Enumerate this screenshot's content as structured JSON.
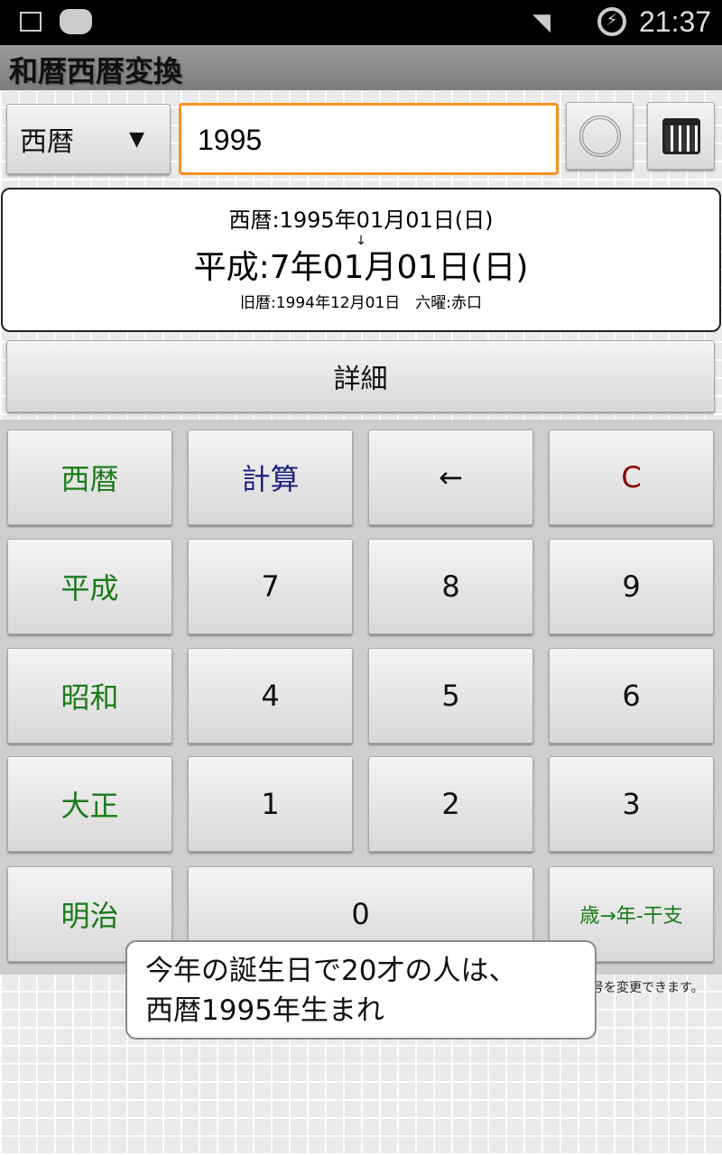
{
  "status": {
    "time": "21:37"
  },
  "app": {
    "title": "和暦西暦変換"
  },
  "input": {
    "era_select": "西暦",
    "value": "1995"
  },
  "result": {
    "western": "西暦:1995年01月01日(日)",
    "arrow": "↓",
    "japanese": "平成:7年01月01日(日)",
    "extra": "旧暦:1994年12月01日　六曜:赤口"
  },
  "detail_label": "詳細",
  "keys": [
    {
      "label": "西暦",
      "color": "#1a7a1a"
    },
    {
      "label": "計算",
      "color": "#1a237e"
    },
    {
      "label": "←",
      "color": "#111111"
    },
    {
      "label": "C",
      "color": "#8b0000"
    },
    {
      "label": "平成",
      "color": "#1a7a1a"
    },
    {
      "label": "7"
    },
    {
      "label": "8"
    },
    {
      "label": "9"
    },
    {
      "label": "昭和",
      "color": "#1a7a1a"
    },
    {
      "label": "4"
    },
    {
      "label": "5"
    },
    {
      "label": "6"
    },
    {
      "label": "大正",
      "color": "#1a7a1a"
    },
    {
      "label": "1"
    },
    {
      "label": "2"
    },
    {
      "label": "3"
    },
    {
      "label": "明治",
      "color": "#1a7a1a"
    },
    {
      "label": "0"
    },
    {
      "label": "歳→年-干支",
      "color": "#1a7a1a"
    }
  ],
  "hint": "号を変更できます。",
  "tooltip": {
    "line1": "今年の誕生日で20才の人は、",
    "line2": "西暦1995年生まれ"
  },
  "colors": {
    "accent": "#f7931e"
  }
}
